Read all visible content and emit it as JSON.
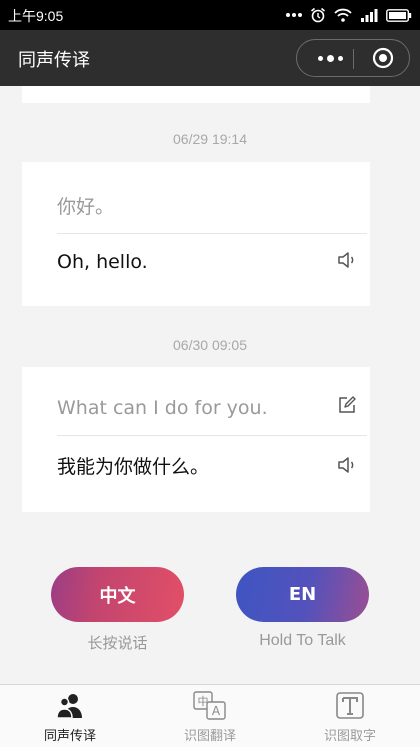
{
  "status_bar": {
    "time": "上午9:05"
  },
  "header": {
    "title": "同声传译"
  },
  "conversation": [
    {
      "timestamp": "06/29 19:14",
      "source": "你好。",
      "translation": "Oh, hello."
    },
    {
      "timestamp": "06/30 09:05",
      "source": "What can I do for you.",
      "translation": "我能为你做什么。"
    }
  ],
  "talk_buttons": {
    "zh": {
      "label": "中文",
      "hint": "长按说话"
    },
    "en": {
      "label": "EN",
      "hint": "Hold To Talk"
    }
  },
  "tabs": [
    {
      "label": "同声传译",
      "icon": "people-icon",
      "active": true
    },
    {
      "label": "识图翻译",
      "icon": "image-translate-icon",
      "active": false
    },
    {
      "label": "识图取字",
      "icon": "text-recognition-icon",
      "active": false
    }
  ],
  "colors": {
    "zh_button": "#e24f67",
    "en_button": "#4a55c0",
    "header_bg": "#2e2e2e"
  }
}
